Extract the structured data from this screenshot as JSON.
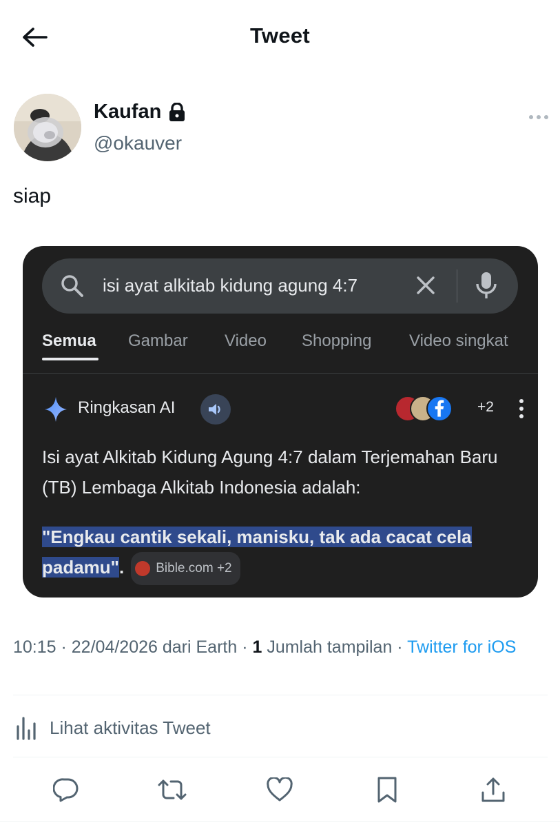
{
  "header": {
    "title": "Tweet",
    "back_icon": "arrow-left-icon"
  },
  "author": {
    "name": "Kaufan",
    "handle": "@okauver",
    "protected_icon": "lock-icon"
  },
  "tweet": {
    "text": "siap"
  },
  "media": {
    "search": {
      "query": "isi ayat alkitab kidung agung 4:7"
    },
    "tabs": [
      "Semua",
      "Gambar",
      "Video",
      "Shopping",
      "Video singkat"
    ],
    "active_tab": "Semua",
    "ai_overview": {
      "label": "Ringkasan AI",
      "sources_more": "+2",
      "body": "Isi ayat Alkitab Kidung Agung 4:7 dalam Terjemahan Baru (TB) Lembaga Alkitab Indonesia adalah:",
      "quote": "\"Engkau cantik sekali, manisku, tak ada cacat cela padamu\"",
      "quote_end": ".",
      "citation": "Bible.com +2"
    }
  },
  "meta": {
    "time": "10:15",
    "sep1": " · ",
    "date": "22/04/2026",
    "from": " dari Earth",
    "sep2": " · ",
    "views_count": "1",
    "views_label": " Jumlah tampilan",
    "sep3": " · ",
    "client": "Twitter for iOS"
  },
  "activity": {
    "label": "Lihat aktivitas Tweet"
  },
  "colors": {
    "accent": "#1d9bf0",
    "text": "#0f1419",
    "secondary": "#536471",
    "media_bg": "#1f1f1f"
  }
}
